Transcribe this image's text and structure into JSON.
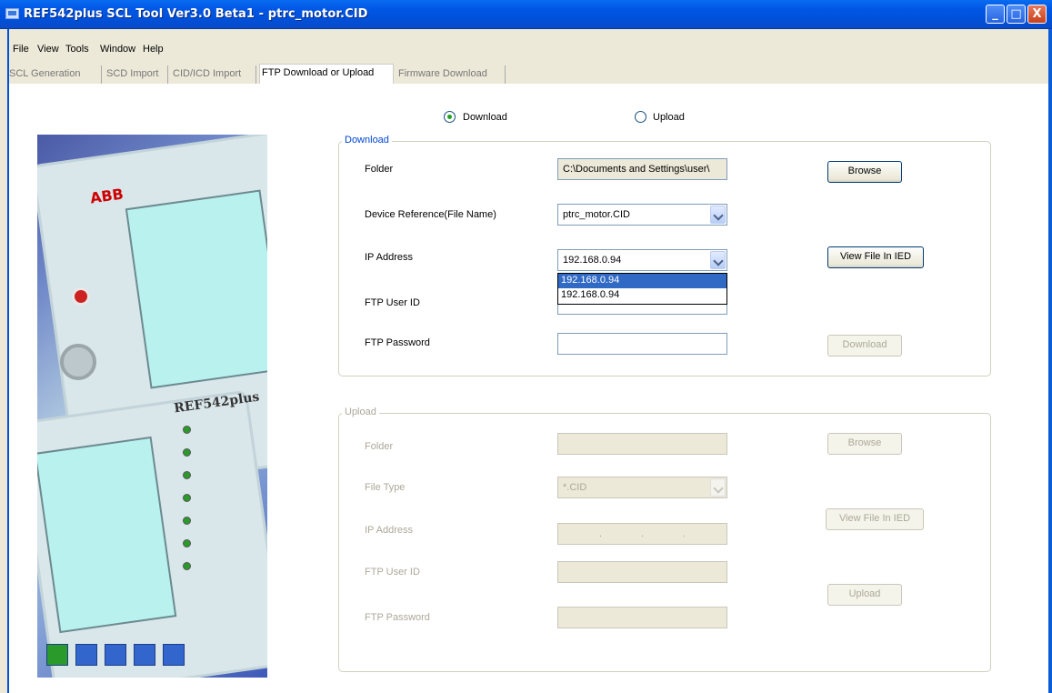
{
  "window": {
    "title": "REF542plus SCL Tool Ver3.0 Beta1 - ptrc_motor.CID",
    "min_glyph": "_",
    "max_glyph": "□",
    "close_glyph": "X"
  },
  "menu": [
    "File",
    "View",
    "Tools",
    "Window",
    "Help"
  ],
  "tabs": [
    "SCL Generation",
    "SCD Import",
    "CID/ICD Import",
    "FTP Download or Upload",
    "Firmware Download"
  ],
  "active_tab": "FTP Download or Upload",
  "mode": {
    "download_label": "Download",
    "upload_label": "Upload",
    "selected": "Download"
  },
  "download": {
    "group_title": "Download",
    "folder_label": "Folder",
    "folder_value": "C:\\Documents and Settings\\user\\",
    "browse_label": "Browse",
    "device_ref_label": "Device Reference(File Name)",
    "device_ref_value": "ptrc_motor.CID",
    "ip_label": "IP Address",
    "ip_value": "192.168.0.94",
    "ip_options": [
      "192.168.0.94",
      "192.168.0.94"
    ],
    "view_file_label": "View File In IED",
    "ftp_user_label": "FTP User ID",
    "ftp_user_value": "",
    "ftp_password_label": "FTP Password",
    "ftp_password_value": "",
    "download_button_label": "Download"
  },
  "upload": {
    "group_title": "Upload",
    "folder_label": "Folder",
    "folder_value": "",
    "browse_label": "Browse",
    "file_type_label": "File Type",
    "file_type_value": "*.CID",
    "ip_label": "IP Address",
    "view_file_label": "View File In IED",
    "ftp_user_label": "FTP User ID",
    "ftp_password_label": "FTP Password",
    "upload_button_label": "Upload"
  },
  "colors": {
    "titlebar": "#0058e6",
    "group_title": "#0046d5",
    "selection": "#316ac5"
  }
}
